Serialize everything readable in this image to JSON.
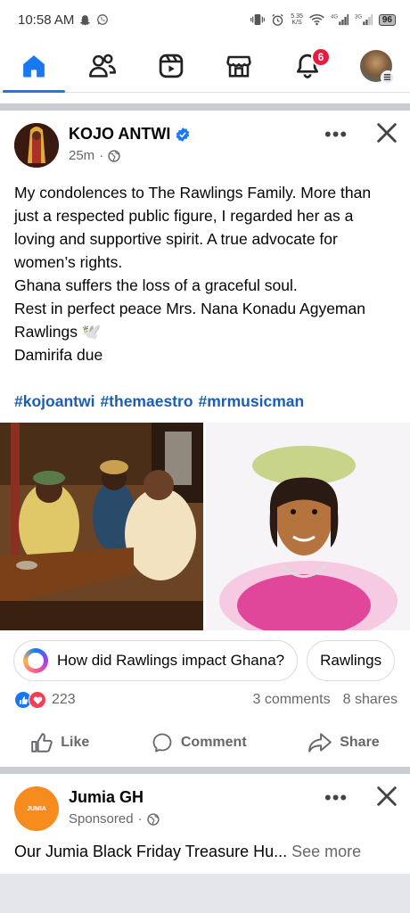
{
  "status_bar": {
    "time": "10:58 AM",
    "net_speed_value": "5.35",
    "net_speed_unit": "K/S",
    "battery": "96"
  },
  "nav": {
    "items": [
      {
        "name": "home",
        "active": true
      },
      {
        "name": "friends",
        "active": false
      },
      {
        "name": "reels",
        "active": false
      },
      {
        "name": "marketplace",
        "active": false
      },
      {
        "name": "notifications",
        "active": false,
        "badge": "6"
      },
      {
        "name": "profile-menu",
        "active": false
      }
    ]
  },
  "post": {
    "author": "KOJO ANTWI",
    "verified": true,
    "time": "25m",
    "separator": "·",
    "visibility_icon": "globe-icon",
    "more_icon": "•••",
    "text": "My condolences to The Rawlings Family. More than just a respected public figure, I regarded her as a loving and supportive spirit. A true advocate for women’s rights.\nGhana suffers the loss of a graceful soul.\nRest in perfect peace Mrs. Nana Konadu Agyeman Rawlings 🕊️\nDamirifa due",
    "hashtags": [
      "#kojoantwi",
      "#themaestro",
      "#mrmusicman"
    ],
    "suggestions": [
      "How did Rawlings impact Ghana?",
      "Rawlings"
    ],
    "reaction_count": "223",
    "comments": "3 comments",
    "shares": "8 shares",
    "actions": {
      "like": "Like",
      "comment": "Comment",
      "share": "Share"
    }
  },
  "ad": {
    "name": "Jumia GH",
    "logo_text": "JUMIA",
    "sponsored": "Sponsored",
    "separator": "·",
    "text": "Our Jumia Black Friday Treasure Hu...",
    "see_more": "See more"
  },
  "colors": {
    "brand_blue": "#1877f2",
    "notification_red": "#e41e3f",
    "hashtag_blue": "#1a5fb4",
    "jumia_orange": "#f68b1e"
  }
}
